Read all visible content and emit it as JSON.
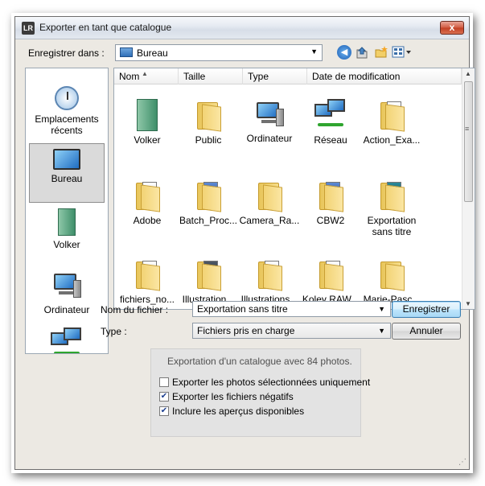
{
  "window": {
    "title": "Exporter en tant que catalogue",
    "app_icon_text": "LR",
    "close_glyph": "x"
  },
  "location": {
    "label": "Enregistrer dans :",
    "value": "Bureau"
  },
  "places": [
    {
      "label": "Emplacements récents",
      "icon": "recent-places-icon",
      "selected": false
    },
    {
      "label": "Bureau",
      "icon": "desktop-icon",
      "selected": true
    },
    {
      "label": "Volker",
      "icon": "user-folder-icon",
      "selected": false
    },
    {
      "label": "Ordinateur",
      "icon": "computer-icon",
      "selected": false
    },
    {
      "label": "",
      "icon": "network-icon",
      "selected": false
    }
  ],
  "columns": [
    "Nom",
    "Taille",
    "Type",
    "Date de modification"
  ],
  "files": [
    {
      "name": "Volker",
      "kind": "user-folder"
    },
    {
      "name": "Public",
      "kind": "folder"
    },
    {
      "name": "Ordinateur",
      "kind": "computer"
    },
    {
      "name": "Réseau",
      "kind": "network"
    },
    {
      "name": "Action_Exa...",
      "kind": "folder-doc"
    },
    {
      "name": "Adobe",
      "kind": "folder-light"
    },
    {
      "name": "Batch_Proc...",
      "kind": "folder-blue"
    },
    {
      "name": "Camera_Ra...",
      "kind": "folder"
    },
    {
      "name": "CBW2",
      "kind": "folder-blue"
    },
    {
      "name": "Exportation sans titre",
      "kind": "folder-teal"
    },
    {
      "name": "fichiers_no...",
      "kind": "folder-light"
    },
    {
      "name": "Illustration...",
      "kind": "folder-dark"
    },
    {
      "name": "Illustrations...",
      "kind": "folder-light"
    },
    {
      "name": "Koley RAW...",
      "kind": "folder-doc"
    },
    {
      "name": "Marie-Pasc...",
      "kind": "folder"
    }
  ],
  "filename": {
    "label": "Nom du fichier :",
    "value": "Exportation sans titre"
  },
  "filetype": {
    "label": "Type :",
    "value": "Fichiers pris en charge"
  },
  "buttons": {
    "save": "Enregistrer",
    "cancel": "Annuler"
  },
  "options": {
    "summary": "Exportation d'un catalogue avec 84 photos.",
    "checkboxes": [
      {
        "label": "Exporter les photos sélectionnées uniquement",
        "checked": false
      },
      {
        "label": "Exporter les fichiers négatifs",
        "checked": true
      },
      {
        "label": "Inclure les aperçus disponibles",
        "checked": true
      }
    ]
  }
}
